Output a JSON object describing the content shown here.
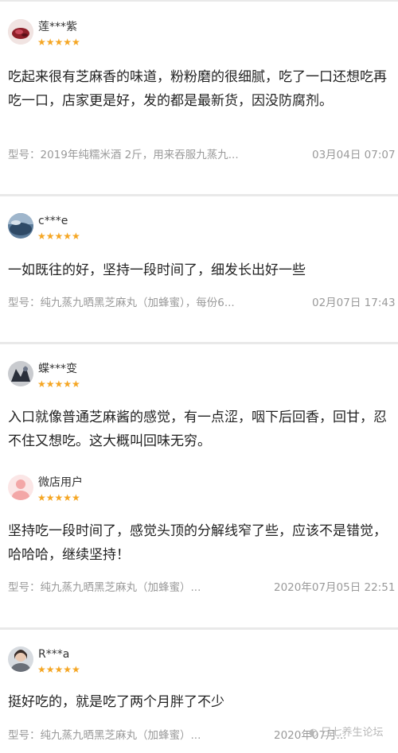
{
  "reviews": [
    {
      "username": "莲***紫",
      "stars": "★★★★★",
      "content": "吃起来很有芝麻香的味道，粉粉磨的很细腻，吃了一口还想吃再吃一口，店家更是好，发的都是最新货，因没防腐剂。",
      "sku": "型号：2019年纯糯米酒 2斤，用来吞服九蒸九...",
      "date": "03月04日 07:07"
    },
    {
      "username": "c***e",
      "stars": "★★★★★",
      "content": "一如既往的好，坚持一段时间了，细发长出好一些",
      "sku": "型号：纯九蒸九晒黑芝麻丸（加蜂蜜），每份6...",
      "date": "02月07日 17:43"
    },
    {
      "username": "蝶***变",
      "stars": "★★★★★",
      "content": "入口就像普通芝麻酱的感觉，有一点涩，咽下后回香，回甘，忍不住又想吃。这大概叫回味无穷。"
    },
    {
      "username": "微店用户",
      "stars": "★★★★★",
      "content": "坚持吃一段时间了，感觉头顶的分解线窄了些，应该不是错觉，哈哈哈，继续坚持！",
      "sku": "型号：纯九蒸九晒黑芝麻丸（加蜂蜜）...",
      "date": "2020年07月05日 22:51"
    },
    {
      "username": "R***a",
      "stars": "★★★★★",
      "content": "挺好吃的，就是吃了两个月胖了不少",
      "sku": "型号：纯九蒸九晒黑芝麻丸（加蜂蜜）...",
      "date": "2020年07月..."
    }
  ],
  "watermark": "巳七养生论坛",
  "colors": {
    "stars": "#f5a623",
    "meta_text": "#9a9a9a",
    "divider": "#e9e9e9"
  }
}
